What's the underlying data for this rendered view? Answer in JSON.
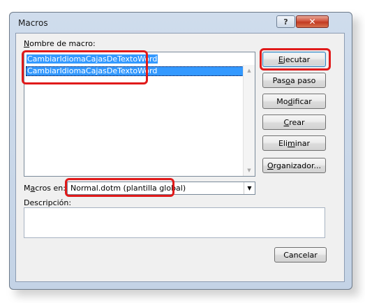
{
  "window": {
    "title": "Macros",
    "help_glyph": "?",
    "close_glyph": "✕"
  },
  "macro_name": {
    "label": "Nombre de macro:",
    "label_hotkey": "N",
    "label_rest": "ombre de macro:",
    "value": "CambiarIdiomaCajasDeTextoWord"
  },
  "macro_list": {
    "items": [
      "CambiarIdiomaCajasDeTextoWord"
    ],
    "selected_index": 0
  },
  "buttons": {
    "ejecutar": {
      "hotkey": "E",
      "rest": "jecutar"
    },
    "paso": {
      "pre": "Pas",
      "hotkey": "o",
      "rest": " a paso"
    },
    "modificar": {
      "pre": "Mo",
      "hotkey": "d",
      "rest": "ificar"
    },
    "crear": {
      "hotkey": "C",
      "rest": "rear"
    },
    "eliminar": {
      "pre": "Eli",
      "hotkey": "m",
      "rest": "inar"
    },
    "organizador": {
      "hotkey": "O",
      "rest": "rganizador..."
    },
    "cancelar": "Cancelar"
  },
  "macros_en": {
    "label_pre": "M",
    "label_hotkey": "a",
    "label_rest": "cros en:",
    "value": "Normal.dotm (plantilla global)"
  },
  "description": {
    "label": "Descripción:",
    "value": ""
  },
  "icons": {
    "scroll_up": "▲",
    "scroll_down": "▼",
    "dropdown": "▼"
  },
  "colors": {
    "highlight_red": "#e01a1a",
    "selection_blue": "#3399ff"
  }
}
